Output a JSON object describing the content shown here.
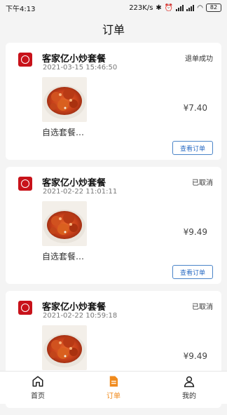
{
  "status_bar": {
    "time": "下午4:13",
    "speed": "223K/s",
    "battery": "82"
  },
  "header": {
    "title": "订单"
  },
  "orders": [
    {
      "shop": "客家亿小炒套餐",
      "time": "2021-03-15 15:46:50",
      "status": "退单成功",
      "desc": "自选套餐…",
      "price": "¥7.40",
      "button": "查看订单"
    },
    {
      "shop": "客家亿小炒套餐",
      "time": "2021-02-22 11:01:11",
      "status": "已取消",
      "desc": "自选套餐…",
      "price": "¥9.49",
      "button": "查看订单"
    },
    {
      "shop": "客家亿小炒套餐",
      "time": "2021-02-22 10:59:18",
      "status": "已取消",
      "desc": "",
      "price": "¥9.49",
      "button": ""
    }
  ],
  "tabs": [
    {
      "label": "首页",
      "icon": "home-icon"
    },
    {
      "label": "订单",
      "icon": "order-icon"
    },
    {
      "label": "我的",
      "icon": "user-icon"
    }
  ],
  "colors": {
    "accent": "#f08a1c",
    "link": "#2b6cc4",
    "brand_red": "#c8121a"
  }
}
